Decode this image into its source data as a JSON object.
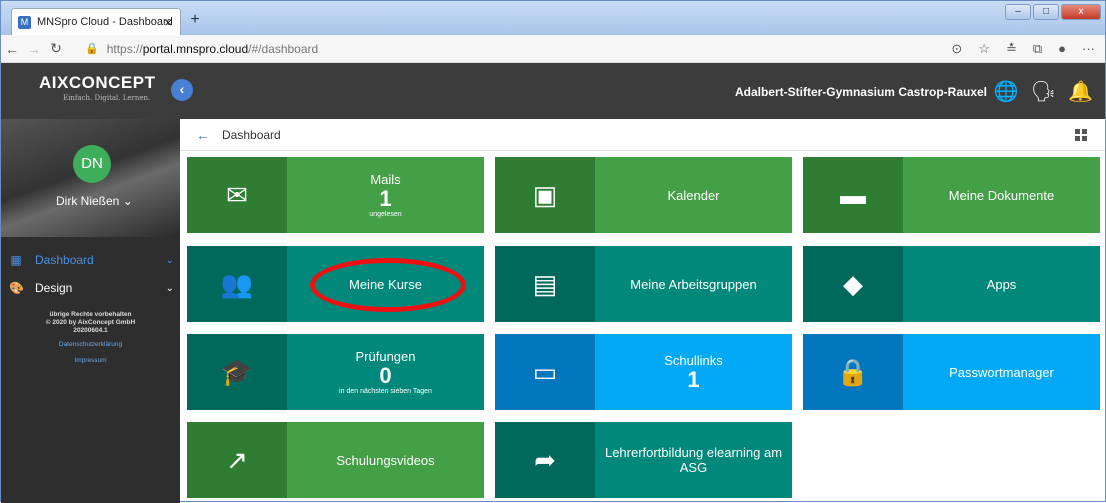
{
  "browser": {
    "tab_title": "MNSpro Cloud - Dashboard",
    "tab_close": "×",
    "new_tab": "+",
    "url_prefix": "https://",
    "url_host": "portal.mnspro.cloud",
    "url_path": "/#/dashboard",
    "more": "···"
  },
  "header": {
    "logo": "AIXCONCEPT",
    "tagline": "Einfach. Digital. Lernen.",
    "school": "Adalbert-Stifter-Gymnasium Castrop-Rauxel"
  },
  "user": {
    "initials": "DN",
    "name": "Dirk Nießen"
  },
  "sidebar": {
    "items": [
      {
        "label": "Dashboard",
        "icon": "dashboard-icon"
      },
      {
        "label": "Design",
        "icon": "palette-icon"
      }
    ],
    "footer": [
      "übrige Rechte vorbehalten",
      "© 2020 by AixConcept GmbH",
      "20200604.1"
    ],
    "links": [
      "Datenschutzerklärung",
      "Impressum"
    ]
  },
  "breadcrumb": {
    "label": "Dashboard"
  },
  "tiles": [
    {
      "label": "Mails",
      "value": "1",
      "sub": "ungelesen",
      "icon": "mail-icon"
    },
    {
      "label": "Kalender",
      "icon": "calendar-icon"
    },
    {
      "label": "Meine Dokumente",
      "icon": "folder-icon"
    },
    {
      "label": "Meine Kurse",
      "icon": "people-icon"
    },
    {
      "label": "Meine Arbeitsgruppen",
      "icon": "workgroup-icon"
    },
    {
      "label": "Apps",
      "icon": "apps-icon"
    },
    {
      "label": "Prüfungen",
      "value": "0",
      "sub": "in den nächsten sieben Tagen",
      "icon": "graduation-icon"
    },
    {
      "label": "Schullinks",
      "value": "1",
      "icon": "browser-icon"
    },
    {
      "label": "Passwortmanager",
      "icon": "lock-icon"
    },
    {
      "label": "Schulungsvideos",
      "icon": "external-link-icon"
    },
    {
      "label": "Lehrerfortbildung elearning am ASG",
      "icon": "directions-icon"
    }
  ],
  "colors": {
    "header": "#3c3c3c",
    "sidebar": "#2e2e2e",
    "green": "#43a047",
    "teal": "#00897b",
    "blue": "#03a9f4",
    "highlight": "#e11111"
  }
}
